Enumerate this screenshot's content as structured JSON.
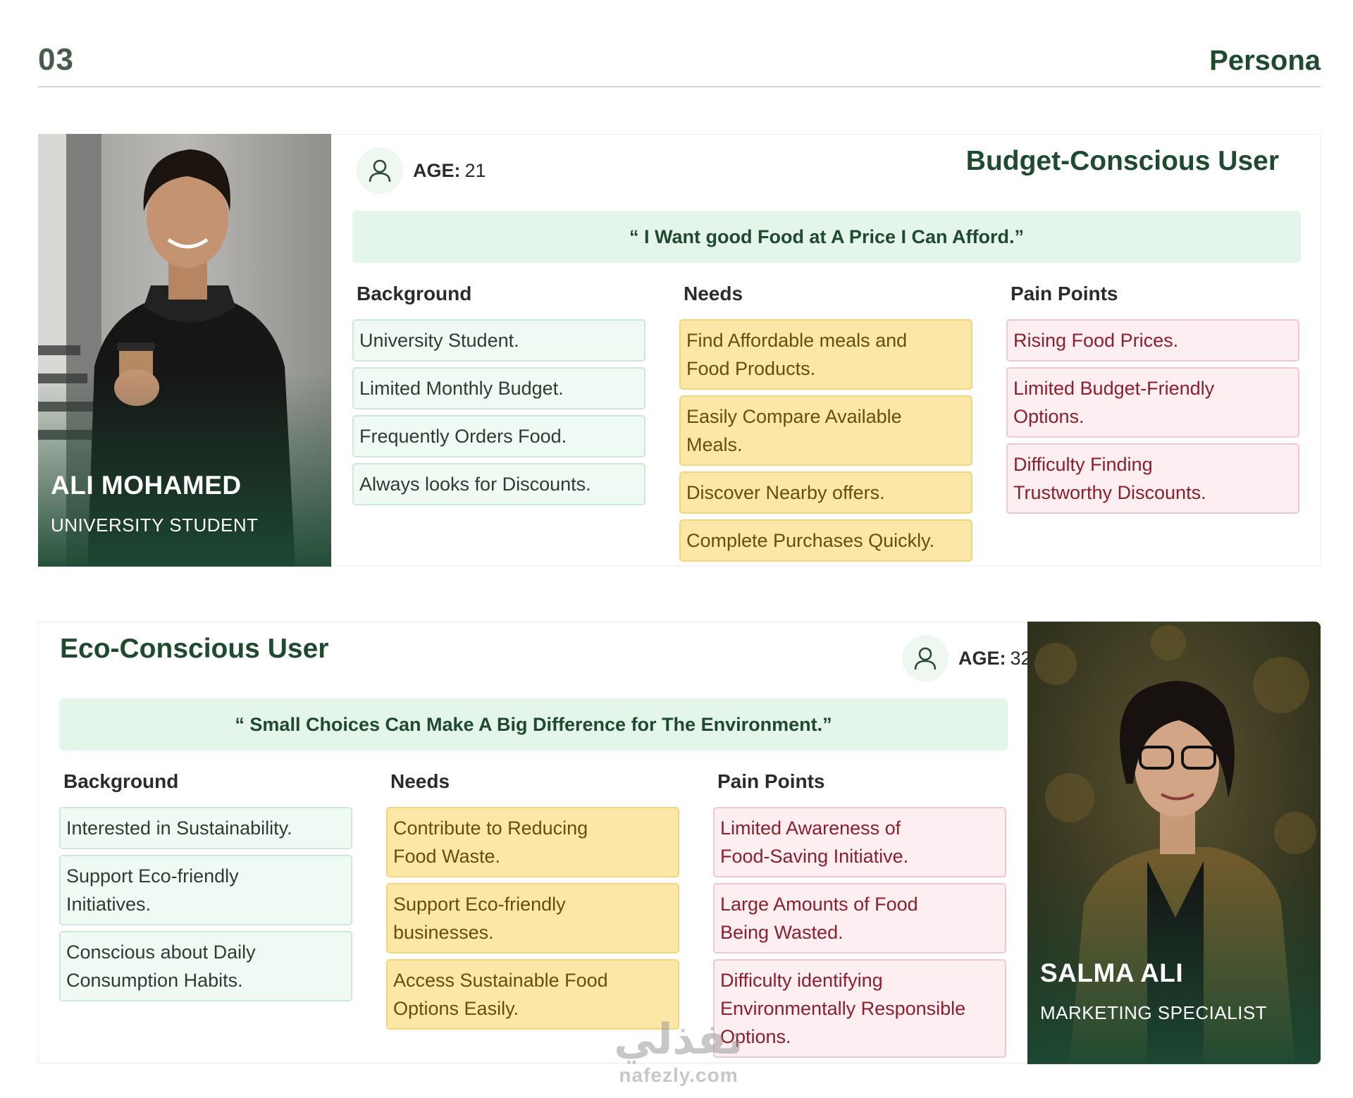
{
  "header": {
    "number": "03",
    "section": "Persona"
  },
  "personas": [
    {
      "name": "ALI MOHAMED",
      "role": "UNIVERSITY STUDENT",
      "age_label": "AGE:",
      "age_value": "21",
      "title": "Budget-Conscious User",
      "quote": "“ I Want good Food at A Price I Can Afford.”",
      "columns": {
        "background": {
          "title": "Background",
          "items": [
            "University Student.",
            "Limited Monthly Budget.",
            "Frequently Orders Food.",
            "Always looks for Discounts."
          ]
        },
        "needs": {
          "title": "Needs",
          "items": [
            "Find Affordable meals and\nFood Products.",
            "Easily Compare Available\nMeals.",
            "Discover Nearby offers.",
            "Complete Purchases Quickly."
          ]
        },
        "pain_points": {
          "title": "Pain Points",
          "items": [
            "Rising Food Prices.",
            "Limited Budget-Friendly\n Options.",
            "Difficulty Finding\nTrustworthy Discounts."
          ]
        }
      }
    },
    {
      "name": "SALMA ALI",
      "role": "MARKETING SPECIALIST",
      "age_label": "AGE:",
      "age_value": "32",
      "title": "Eco-Conscious User",
      "quote": "“ Small Choices Can Make A Big Difference for The Environment.”",
      "columns": {
        "background": {
          "title": "Background",
          "items": [
            "Interested in Sustainability.",
            "Support Eco-friendly\nInitiatives.",
            "Conscious about Daily\n Consumption Habits."
          ]
        },
        "needs": {
          "title": "Needs",
          "items": [
            "Contribute to Reducing\n Food Waste.",
            "Support Eco-friendly\nbusinesses.",
            "Access Sustainable Food\n Options Easily."
          ]
        },
        "pain_points": {
          "title": "Pain Points",
          "items": [
            "Limited Awareness of\nFood-Saving Initiative.",
            "Large Amounts of Food\n Being Wasted.",
            "Difficulty identifying\nEnvironmentally Responsible\nOptions."
          ]
        }
      }
    }
  ],
  "watermark": {
    "arabic": "نفذلي",
    "latin": "nafezly.com"
  },
  "colors": {
    "brand_green": "#1f4a30",
    "quote_bg": "#e4f5ea",
    "background_item": "#eefaf3",
    "need_item": "#fbe8a6",
    "pain_item": "#fdeff1"
  },
  "icons": [
    "user-icon"
  ]
}
